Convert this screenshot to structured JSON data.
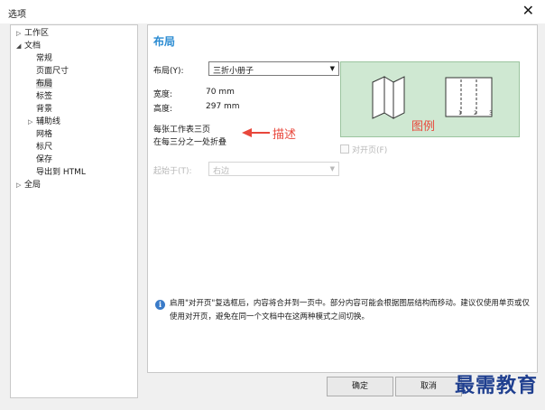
{
  "window": {
    "title": "选项",
    "close_icon": "✕"
  },
  "tree": [
    {
      "label": "工作区",
      "arrow": "▷"
    },
    {
      "label": "文档",
      "arrow": "◢"
    },
    {
      "label": "常规",
      "arrow": ""
    },
    {
      "label": "页面尺寸",
      "arrow": ""
    },
    {
      "label": "布局",
      "arrow": "",
      "selected": true
    },
    {
      "label": "标签",
      "arrow": ""
    },
    {
      "label": "背景",
      "arrow": ""
    },
    {
      "label": "辅助线",
      "arrow": "▷"
    },
    {
      "label": "网格",
      "arrow": ""
    },
    {
      "label": "标尺",
      "arrow": ""
    },
    {
      "label": "保存",
      "arrow": ""
    },
    {
      "label": "导出到 HTML",
      "arrow": ""
    },
    {
      "label": "全局",
      "arrow": "▷"
    }
  ],
  "panel": {
    "heading": "布局",
    "layout_label": "布局(Y):",
    "layout_value": "三折小册子",
    "width_label": "宽度:",
    "width_value": "70 mm",
    "height_label": "高度:",
    "height_value": "297 mm",
    "description_line1": "每张工作表三页",
    "description_line2": "在每三分之一处折叠",
    "annotation_describe": "描述",
    "annotation_legend": "图例",
    "facing_pages_label": "对开页(F)",
    "start_label": "起始于(T):",
    "start_value": "右边",
    "info_text": "启用\"对开页\"复选框后，内容将合并到一页中。部分内容可能会根据图层结构而移动。建议仅使用单页或仅使用对开页，避免在同一个文档中在这两种模式之间切换。",
    "preview_numbers": [
      "1",
      "2",
      "3"
    ]
  },
  "buttons": {
    "ok": "确定",
    "cancel": "取消"
  },
  "watermark": "最需教育",
  "colors": {
    "accent": "#2a8bd2",
    "annotation": "#e8473b",
    "preview_bg": "#cfe8d2"
  }
}
